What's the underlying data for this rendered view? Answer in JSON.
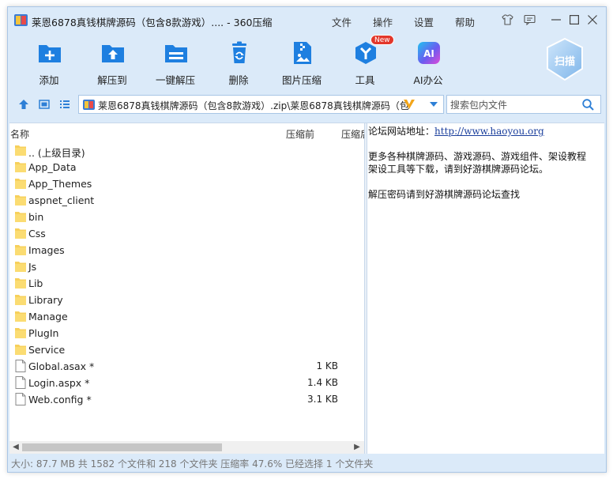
{
  "window": {
    "title": "莱恩6878真钱棋牌源码（包含8款游戏）.... - 360压缩",
    "menu": [
      "文件",
      "操作",
      "设置",
      "帮助"
    ]
  },
  "toolbar": {
    "items": [
      {
        "label": "添加",
        "icon": "add-icon"
      },
      {
        "label": "解压到",
        "icon": "extract-to-icon"
      },
      {
        "label": "一键解压",
        "icon": "one-click-extract-icon"
      },
      {
        "label": "删除",
        "icon": "delete-icon"
      },
      {
        "label": "图片压缩",
        "icon": "image-compress-icon"
      },
      {
        "label": "工具",
        "icon": "tools-icon",
        "badge": "New"
      },
      {
        "label": "AI办公",
        "icon": "ai-office-icon",
        "icon_text": "AI"
      }
    ],
    "scan_label": "扫描"
  },
  "address": {
    "path": "莱恩6878真钱棋牌源码（包含8款游戏）.zip\\莱恩6878真钱棋牌源码（包"
  },
  "search": {
    "placeholder": "搜索包内文件"
  },
  "columns": {
    "name": "名称",
    "size_before": "压缩前",
    "size_after": "压缩后"
  },
  "files": [
    {
      "name": ".. (上级目录)",
      "type": "folder",
      "size": ""
    },
    {
      "name": "App_Data",
      "type": "folder",
      "size": ""
    },
    {
      "name": "App_Themes",
      "type": "folder",
      "size": ""
    },
    {
      "name": "aspnet_client",
      "type": "folder",
      "size": ""
    },
    {
      "name": "bin",
      "type": "folder",
      "size": ""
    },
    {
      "name": "Css",
      "type": "folder",
      "size": ""
    },
    {
      "name": "Images",
      "type": "folder",
      "size": ""
    },
    {
      "name": "Js",
      "type": "folder",
      "size": ""
    },
    {
      "name": "Lib",
      "type": "folder",
      "size": ""
    },
    {
      "name": "Library",
      "type": "folder",
      "size": ""
    },
    {
      "name": "Manage",
      "type": "folder",
      "size": ""
    },
    {
      "name": "PlugIn",
      "type": "folder",
      "size": ""
    },
    {
      "name": "Service",
      "type": "folder",
      "size": ""
    },
    {
      "name": "Global.asax *",
      "type": "file",
      "size": "1 KB"
    },
    {
      "name": "Login.aspx *",
      "type": "file",
      "size": "1.4 KB"
    },
    {
      "name": "Web.config *",
      "type": "file",
      "size": "3.1 KB"
    }
  ],
  "info": {
    "forum_label": "论坛网站地址：",
    "forum_url": "http://www.haoyou.org",
    "line2": "更多各种棋牌源码、游戏源码、游戏组件、架设教程",
    "line3": "架设工具等下载，请到好游棋牌源码论坛。",
    "line4": "解压密码请到好游棋牌源码论坛查找"
  },
  "status": "大小: 87.7 MB 共 1582 个文件和 218 个文件夹 压缩率 47.6% 已经选择 1 个文件夹",
  "colors": {
    "window_bg": "#dbeaf9",
    "accent_blue": "#1e7fe0",
    "badge_red": "#e2372b",
    "folder_yellow": "#f7d05b"
  }
}
